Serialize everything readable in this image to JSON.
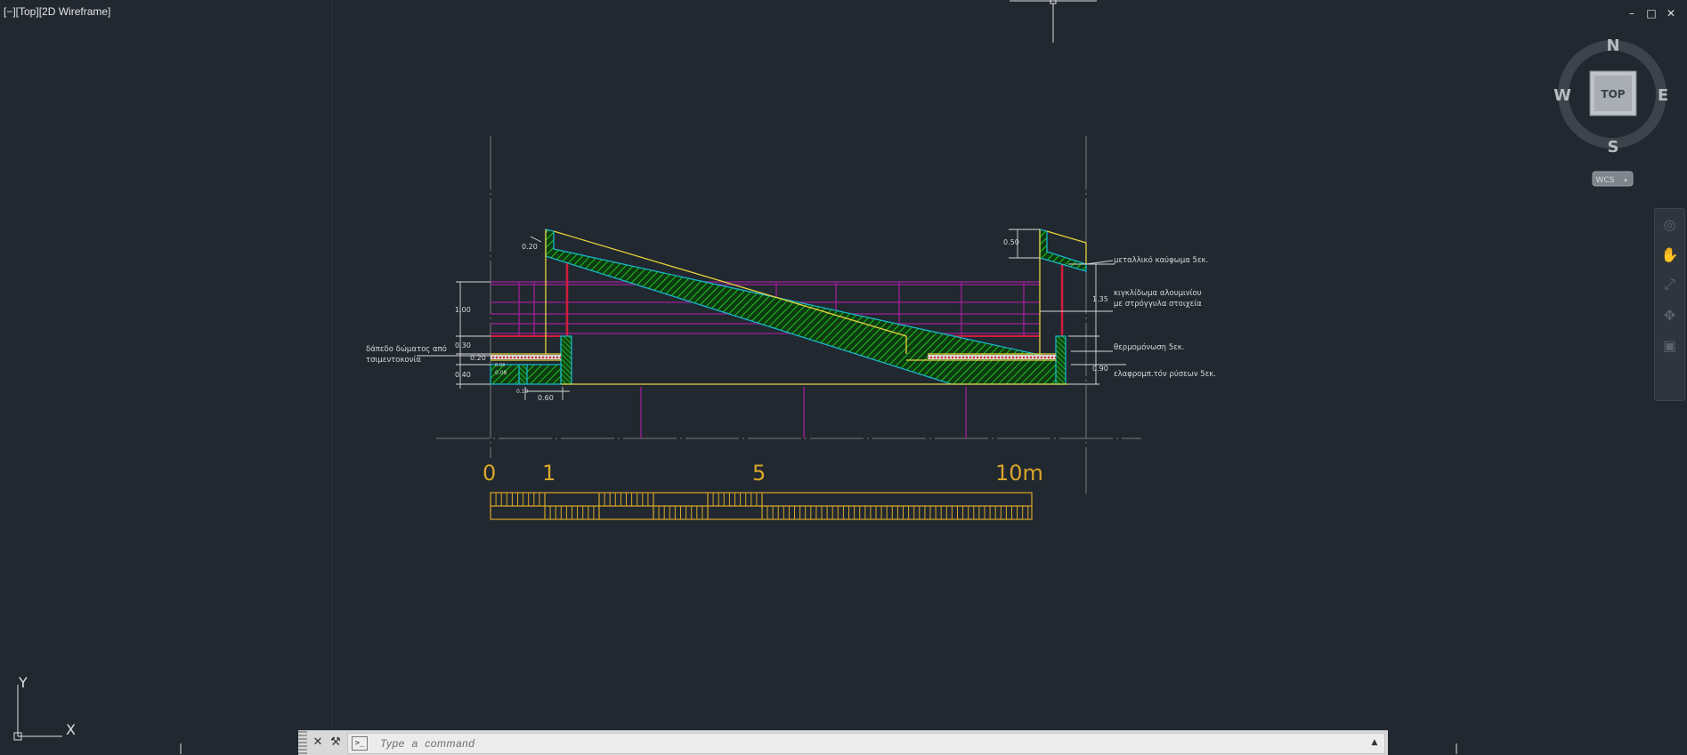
{
  "viewport": {
    "label": "[−][Top][2D Wireframe]"
  },
  "window_controls": {
    "minimize": "–",
    "restore": "□",
    "close": "✕"
  },
  "viewcube": {
    "north": "N",
    "south": "S",
    "east": "E",
    "west": "W",
    "face": "TOP",
    "wcs": "WCS"
  },
  "ucs": {
    "y": "Y",
    "x": "X"
  },
  "drawing": {
    "dims": {
      "d020a": "0.20",
      "d050": "0.50",
      "d100": "1.00",
      "d030": "0.30",
      "d020b": "0.20",
      "d040": "0.40",
      "d008": "0.08",
      "d010": "0.10",
      "d060": "0.60",
      "d135": "1.35",
      "d090": "0.90",
      "d004": "0.04"
    },
    "notes": {
      "floor_line1": "δάπεδο δώματος από",
      "floor_line2": "τσιμεντοκονία",
      "metal_cover": "μεταλλικό καύφωμα 5εκ.",
      "railing_line1": "κιγκλίδωμα αλουμινίου",
      "railing_line2": "με στρόγγυλα στοιχεία",
      "insulation": "θερμομόνωση 5εκ.",
      "slope": "ελαφρομπ.τόν ρύσεων 5εκ."
    },
    "scale": {
      "t0": "0",
      "t1": "1",
      "t5": "5",
      "t10": "10m"
    }
  },
  "command": {
    "placeholder": "Type  a  command",
    "close": "✕",
    "customize": "⚒",
    "prompt_icon": ">_",
    "expand": "▲"
  },
  "colors": {
    "background": "#212830",
    "yellow": "#e6d33c",
    "green": "#1fc41f",
    "cyan": "#18b4c8",
    "magenta": "#a0209a",
    "red": "#d21c3c",
    "white": "#d8d8d8",
    "scale": "#d9a62a"
  },
  "navbar_icons": [
    "steering-wheel-icon",
    "pan-icon",
    "zoom-icon",
    "orbit-icon",
    "showmotion-icon"
  ]
}
